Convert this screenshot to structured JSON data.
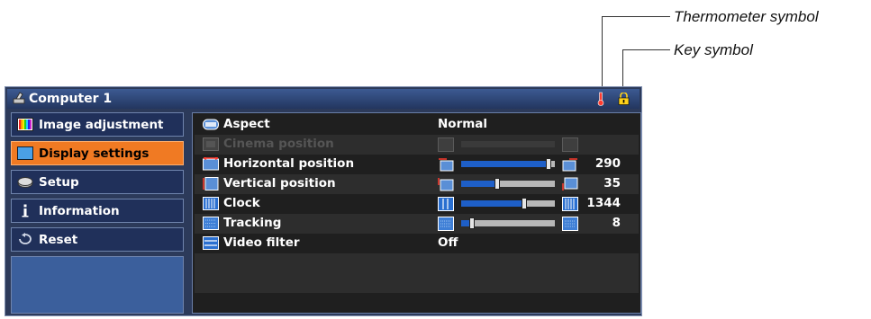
{
  "callouts": {
    "thermometer": "Thermometer symbol",
    "key": "Key symbol"
  },
  "window": {
    "title": "Computer 1",
    "icons": [
      "input-source-icon",
      "thermometer-icon",
      "key-icon"
    ]
  },
  "sidebar": {
    "items": [
      {
        "label": "Image adjustment",
        "icon": "image-adjustment-icon",
        "active": false
      },
      {
        "label": "Display settings",
        "icon": "display-settings-icon",
        "active": true
      },
      {
        "label": "Setup",
        "icon": "setup-icon",
        "active": false
      },
      {
        "label": "Information",
        "icon": "information-icon",
        "active": false
      },
      {
        "label": "Reset",
        "icon": "reset-icon",
        "active": false
      }
    ]
  },
  "settings": {
    "rows": [
      {
        "label": "Aspect",
        "value": "Normal"
      },
      {
        "label": "Cinema position",
        "disabled": true
      },
      {
        "label": "Horizontal position",
        "number": "290",
        "level": 0.93
      },
      {
        "label": "Vertical position",
        "number": "35",
        "level": 0.38
      },
      {
        "label": "Clock",
        "number": "1344",
        "level": 0.67
      },
      {
        "label": "Tracking",
        "number": "8",
        "level": 0.12
      },
      {
        "label": "Video filter",
        "value": "Off"
      }
    ]
  },
  "colors": {
    "accent": "#f07a23",
    "slider_fill": "#1e5fc8",
    "panel_bg": "#1f1f1f",
    "title_bg": "#2c4676"
  }
}
